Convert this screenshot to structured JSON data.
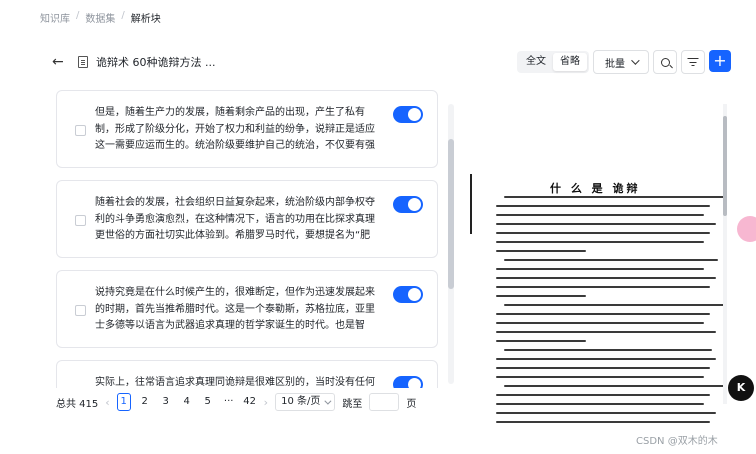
{
  "breadcrumb": {
    "items": [
      "知识库",
      "数据集",
      "解析块"
    ],
    "separator": "/"
  },
  "header": {
    "back_icon": "arrow-left-icon",
    "doc_icon": "document-icon",
    "title": "诡辩术 60种诡辩方法 ..."
  },
  "view_toggle": {
    "full": "全文",
    "outline": "省略",
    "active": "outline"
  },
  "toolbar": {
    "batch_label": "批量",
    "search_icon": "search-icon",
    "filter_icon": "filter-icon",
    "add_icon": "plus-icon",
    "add_label": "+"
  },
  "chunks": [
    {
      "text": "但是，随着生产力的发展，随着剩余产品的出现，产生了私有制，形成了阶级分化，开始了权力和利益的纷争，说辩正是适应这一需要应运而生的。统治阶级要维护自己的统治，不仅要有强大的暴力...",
      "enabled": true
    },
    {
      "text": "随着社会的发展，社会组织日益复杂起来，统治阶级内部争权夺利的斗争勇愈演愈烈，在这种情况下，语言的功用在比探求真理更世俗的方面社切实此体验到。希腊罗马时代，要想提名为“肥缺”的...",
      "enabled": true
    },
    {
      "text": "说持究竟是在什么时候产生的，很难断定，但作为迅速发展起来的时期，首先当推希腊时代。这是一个泰勒斯，苏格拉底，亚里士多德等以语言为武器追求真理的哲学家诞生的时代。也是智者，雄辩...",
      "enabled": true
    },
    {
      "text": "实际上，往常语言追求真理同诡辩是很难区别的，当时没有任何标准",
      "enabled": true
    }
  ],
  "preview": {
    "title": "什 么 是 诡辩"
  },
  "pagination": {
    "total_label": "总共 415",
    "prev_icon": "chevron-left-icon",
    "next_icon": "chevron-right-icon",
    "pages": [
      "1",
      "2",
      "3",
      "4",
      "5",
      "···",
      "42"
    ],
    "active_page": "1",
    "page_size": "10 条/页",
    "jump_label": "跳至",
    "page_suffix": "页"
  },
  "floating": {
    "assistant_icon": "flower-icon",
    "dark_label": "K"
  },
  "watermark": "CSDN @双木的木",
  "colors": {
    "accent": "#1664ff",
    "border": "#e5e6eb"
  }
}
